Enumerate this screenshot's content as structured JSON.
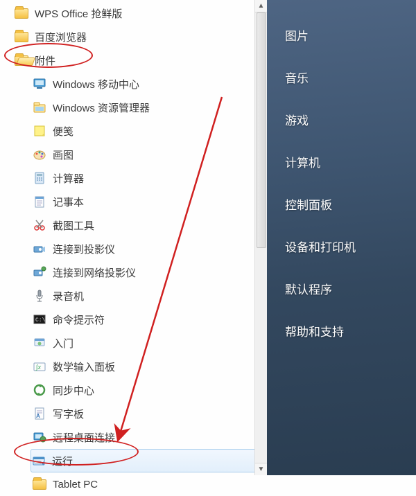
{
  "left": {
    "items": [
      {
        "label": "WPS Office 抢鲜版",
        "icon": "folder"
      },
      {
        "label": "百度浏览器",
        "icon": "folder"
      },
      {
        "label": "附件",
        "icon": "folder-open",
        "circled": true
      },
      {
        "label": "Windows 移动中心",
        "icon": "mobility",
        "child": true
      },
      {
        "label": "Windows 资源管理器",
        "icon": "explorer",
        "child": true
      },
      {
        "label": "便笺",
        "icon": "sticky",
        "child": true
      },
      {
        "label": "画图",
        "icon": "paint",
        "child": true
      },
      {
        "label": "计算器",
        "icon": "calc",
        "child": true
      },
      {
        "label": "记事本",
        "icon": "notepad",
        "child": true
      },
      {
        "label": "截图工具",
        "icon": "snip",
        "child": true
      },
      {
        "label": "连接到投影仪",
        "icon": "projector",
        "child": true
      },
      {
        "label": "连接到网络投影仪",
        "icon": "netproj",
        "child": true
      },
      {
        "label": "录音机",
        "icon": "mic",
        "child": true
      },
      {
        "label": "命令提示符",
        "icon": "cmd",
        "child": true
      },
      {
        "label": "入门",
        "icon": "start",
        "child": true
      },
      {
        "label": "数学输入面板",
        "icon": "math",
        "child": true
      },
      {
        "label": "同步中心",
        "icon": "sync",
        "child": true
      },
      {
        "label": "写字板",
        "icon": "wordpad",
        "child": true
      },
      {
        "label": "远程桌面连接",
        "icon": "remote",
        "child": true
      },
      {
        "label": "运行",
        "icon": "run",
        "child": true,
        "selected": true,
        "circled": true
      },
      {
        "label": "Tablet PC",
        "icon": "folder",
        "child": true
      }
    ]
  },
  "right": {
    "items": [
      {
        "label": "图片"
      },
      {
        "label": "音乐"
      },
      {
        "label": "游戏"
      },
      {
        "label": "计算机"
      },
      {
        "label": "控制面板"
      },
      {
        "label": "设备和打印机"
      },
      {
        "label": "默认程序"
      },
      {
        "label": "帮助和支持"
      }
    ]
  },
  "annotations": {
    "arrow_color": "#d02020"
  }
}
